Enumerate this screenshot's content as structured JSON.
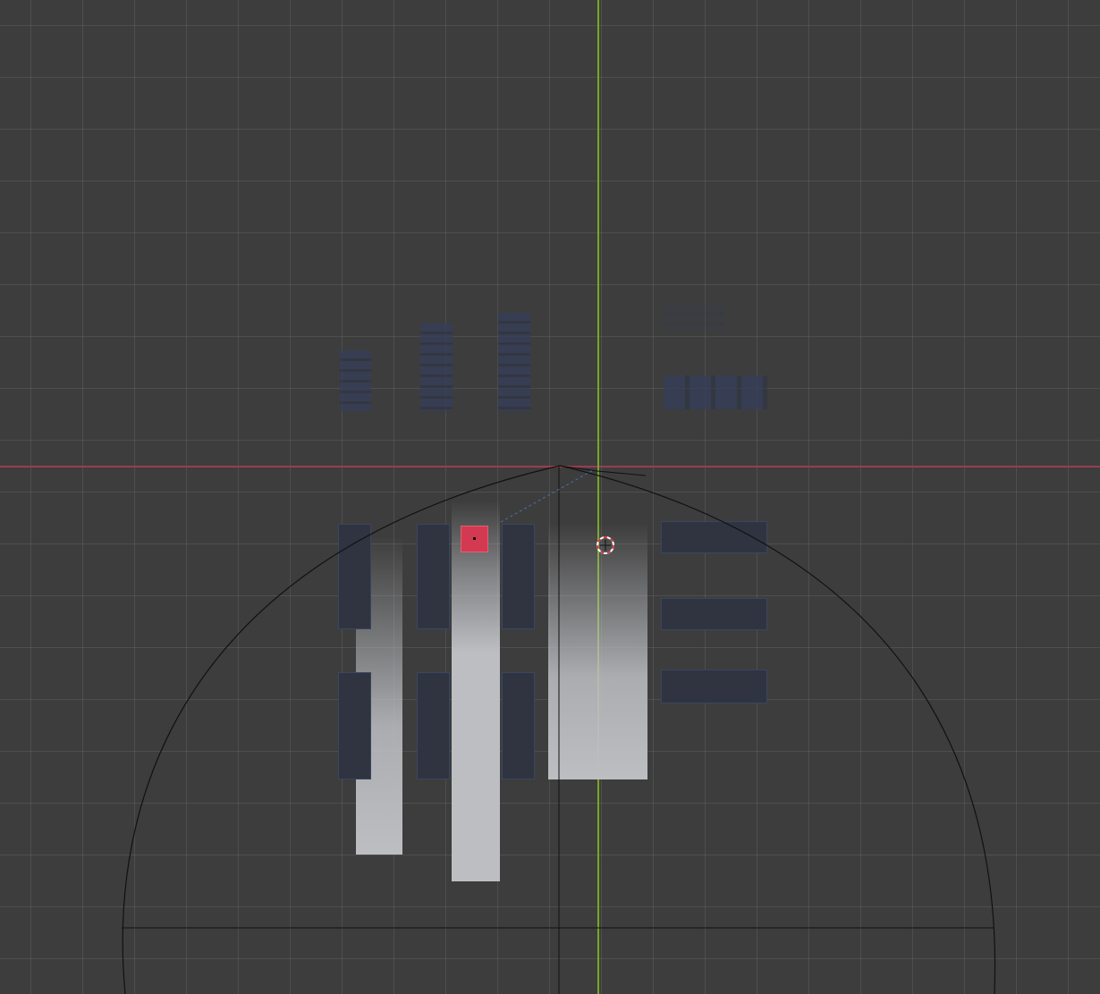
{
  "viewport": {
    "name": "3d-viewport",
    "colors": {
      "background": "#3d3d3d",
      "grid_line": "#4a4a4a",
      "x_axis": "#9a3d4f",
      "y_axis": "#78a824",
      "selected_object": "#d33a52",
      "dark_panel": "#2f3440",
      "particle_light": "#bcbec2"
    },
    "icons": {
      "cursor": "3d-cursor-icon",
      "origin": "object-origin-icon"
    }
  }
}
